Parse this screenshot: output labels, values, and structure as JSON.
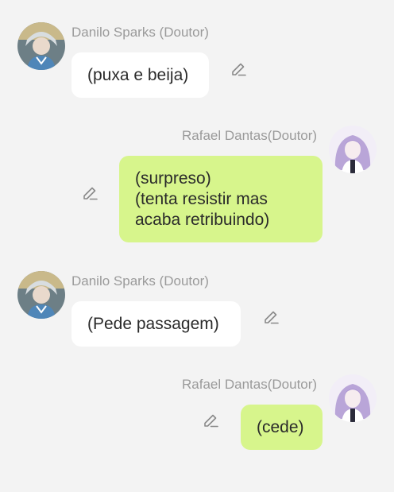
{
  "colors": {
    "background": "#f3f3f3",
    "incoming_bubble": "#ffffff",
    "outgoing_bubble": "#d7f58c",
    "name_text": "#9a9a9a",
    "message_text": "#2a2a2a",
    "edit_icon": "#8a8a8a"
  },
  "messages": [
    {
      "sender": "Danilo Sparks (Doutor)",
      "text": "(puxa e beija)",
      "side": "left",
      "avatar_icon": "avatar-danilo",
      "edit_icon": "pencil-icon"
    },
    {
      "sender": "Rafael Dantas(Doutor)",
      "text": "(surpreso)\n(tenta resistir mas\nacaba retribuindo)",
      "side": "right",
      "avatar_icon": "avatar-rafael",
      "edit_icon": "pencil-icon"
    },
    {
      "sender": "Danilo Sparks (Doutor)",
      "text": "(Pede passagem)",
      "side": "left",
      "avatar_icon": "avatar-danilo",
      "edit_icon": "pencil-icon"
    },
    {
      "sender": "Rafael Dantas(Doutor)",
      "text": "(cede)",
      "side": "right",
      "avatar_icon": "avatar-rafael",
      "edit_icon": "pencil-icon"
    }
  ]
}
